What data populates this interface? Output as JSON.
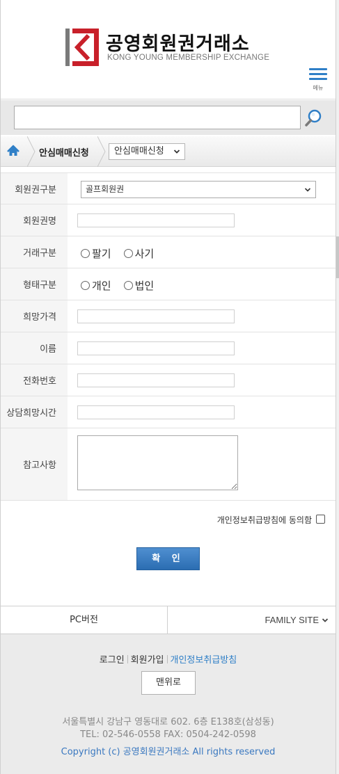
{
  "header": {
    "logo_title": "공영회원권거래소",
    "logo_subtitle": "KONG YOUNG MEMBERSHIP EXCHANGE",
    "menu_label": "메뉴"
  },
  "search": {
    "value": "",
    "placeholder": ""
  },
  "breadcrumb": {
    "current": "안심매매신청",
    "select_value": "안심매매신청"
  },
  "form": {
    "membership_type": {
      "label": "회원권구분",
      "value": "골프회원권"
    },
    "membership_name": {
      "label": "회원권명",
      "value": ""
    },
    "trade_type": {
      "label": "거래구분",
      "options": [
        "팔기",
        "사기"
      ]
    },
    "entity_type": {
      "label": "형태구분",
      "options": [
        "개인",
        "법인"
      ]
    },
    "desired_price": {
      "label": "희망가격",
      "value": ""
    },
    "name": {
      "label": "이름",
      "value": ""
    },
    "phone": {
      "label": "전화번호",
      "value": ""
    },
    "consult_time": {
      "label": "상담희망시간",
      "value": ""
    },
    "notes": {
      "label": "참고사항",
      "value": ""
    },
    "agree_label": "개인정보취급방침에 동의함",
    "confirm_label": "확 인"
  },
  "footer_tabs": {
    "pc": "PC버전",
    "family": "FAMILY SITE"
  },
  "footer": {
    "links": [
      "로그인",
      "회원가입",
      "개인정보취급방침"
    ],
    "top_button": "맨위로",
    "address": "서울특별시 강남구 영동대로 602. 6층 E138호(삼성동)",
    "contact": "TEL: 02-546-0558   FAX: 0504-242-0598",
    "copyright": "Copyright (c) 공영회원권거래소 All rights reserved"
  },
  "colors": {
    "accent": "#2f7fc7",
    "logo_red": "#c8202a",
    "logo_gray": "#7a7a7a"
  }
}
